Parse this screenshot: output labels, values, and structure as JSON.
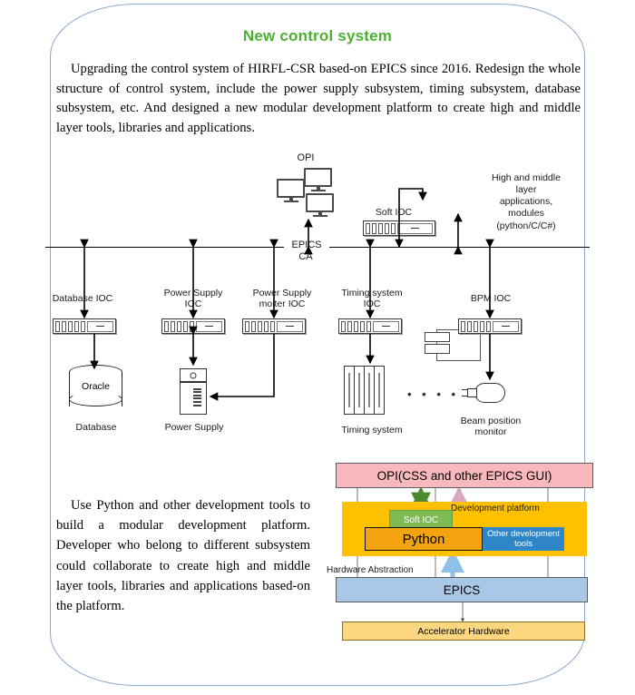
{
  "slide": {
    "title": "New control system",
    "intro_paragraph": "Upgrading the control system of HIRFL-CSR based-on EPICS since 2016. Redesign the whole structure of control system, include the power supply subsystem, timing subsystem, database subsystem, etc. And designed a new modular development platform to create high and middle layer tools, libraries and applications.",
    "platform_paragraph": "Use Python and other development tools to build a modular development platform. Developer who belong to different subsystem could collaborate to create high and middle layer tools, libraries and applications based-on the platform.",
    "title_color": "#4CAF32",
    "frame_color": "#8CAACD"
  },
  "architecture": {
    "bus_label_line1": "EPICS",
    "bus_label_line2": "CA",
    "opi_label": "OPI",
    "soft_ioc_label": "Soft IOC",
    "apps_label": "High and middle\nlayer\napplications,\nmodules\n(python/C/C#)",
    "nodes": [
      {
        "ioc_label": "Database IOC",
        "device_label": "Database",
        "device_name": "Oracle"
      },
      {
        "ioc_label": "Power Supply\nIOC",
        "device_label": "Power Supply"
      },
      {
        "ioc_label": "Power Supply\nmoiter IOC"
      },
      {
        "ioc_label": "Timing system\nIOC",
        "device_label": "Timing system"
      },
      {
        "ioc_label": "BPM IOC",
        "device_label": "Beam position\nmonitor"
      }
    ],
    "ellipsis": "• • • •"
  },
  "platform_stack": {
    "opi": "OPI(CSS and other EPICS GUI)",
    "development_platform": "Development platform",
    "soft_ioc": "Soft IOC",
    "python": "Python",
    "other_tools": "Other development tools",
    "hardware_abstraction": "Hardware Abstraction",
    "epics": "EPICS",
    "accelerator_hardware": "Accelerator Hardware",
    "colors": {
      "opi": "#F9B8BC",
      "platform": "#FFC000",
      "soft_ioc": "#7FBA55",
      "python": "#F2A30F",
      "other_tools": "#2E86C8",
      "epics": "#A9C8E8",
      "accelerator": "#FCD77F"
    }
  }
}
